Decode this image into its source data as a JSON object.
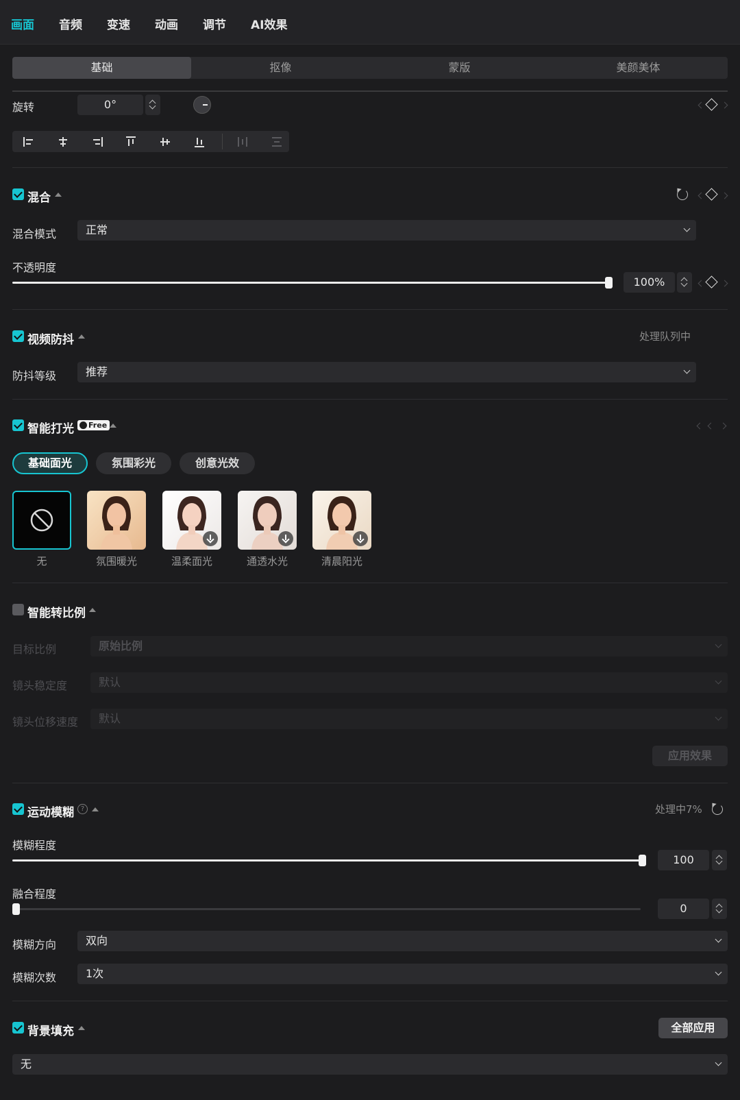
{
  "top_tabs": [
    "画面",
    "音频",
    "变速",
    "动画",
    "调节",
    "AI效果"
  ],
  "sub_tabs": [
    "基础",
    "抠像",
    "蒙版",
    "美颜美体"
  ],
  "rotation": {
    "label": "旋转",
    "value": "0°"
  },
  "blend": {
    "title": "混合",
    "enabled": true,
    "mode_label": "混合模式",
    "mode_value": "正常",
    "opacity_label": "不透明度",
    "opacity_value": "100%",
    "opacity_level": 1.0
  },
  "stabilize": {
    "title": "视频防抖",
    "enabled": true,
    "status": "处理队列中",
    "level_label": "防抖等级",
    "level_value": "推荐"
  },
  "smart_light": {
    "title": "智能打光",
    "enabled": true,
    "badge": "Free",
    "categories": [
      "基础面光",
      "氛围彩光",
      "创意光效"
    ],
    "presets": [
      "无",
      "氛围暖光",
      "温柔面光",
      "通透水光",
      "清晨阳光"
    ]
  },
  "smart_ratio": {
    "title": "智能转比例",
    "enabled": false,
    "target_label": "目标比例",
    "target_value": "原始比例",
    "stability_label": "镜头稳定度",
    "stability_value": "默认",
    "speed_label": "镜头位移速度",
    "speed_value": "默认",
    "apply_label": "应用效果"
  },
  "motion_blur": {
    "title": "运动模糊",
    "enabled": true,
    "status": "处理中7%",
    "degree_label": "模糊程度",
    "degree_value": "100",
    "degree_level": 1.0,
    "blend_label": "融合程度",
    "blend_value": "0",
    "blend_level": 0.0,
    "direction_label": "模糊方向",
    "direction_value": "双向",
    "count_label": "模糊次数",
    "count_value": "1次"
  },
  "background_fill": {
    "title": "背景填充",
    "enabled": true,
    "apply_all_label": "全部应用",
    "value": "无"
  },
  "colors": {
    "accent": "#17c5d1",
    "panel": "#1c1c1e",
    "field": "#2b2b2e"
  }
}
